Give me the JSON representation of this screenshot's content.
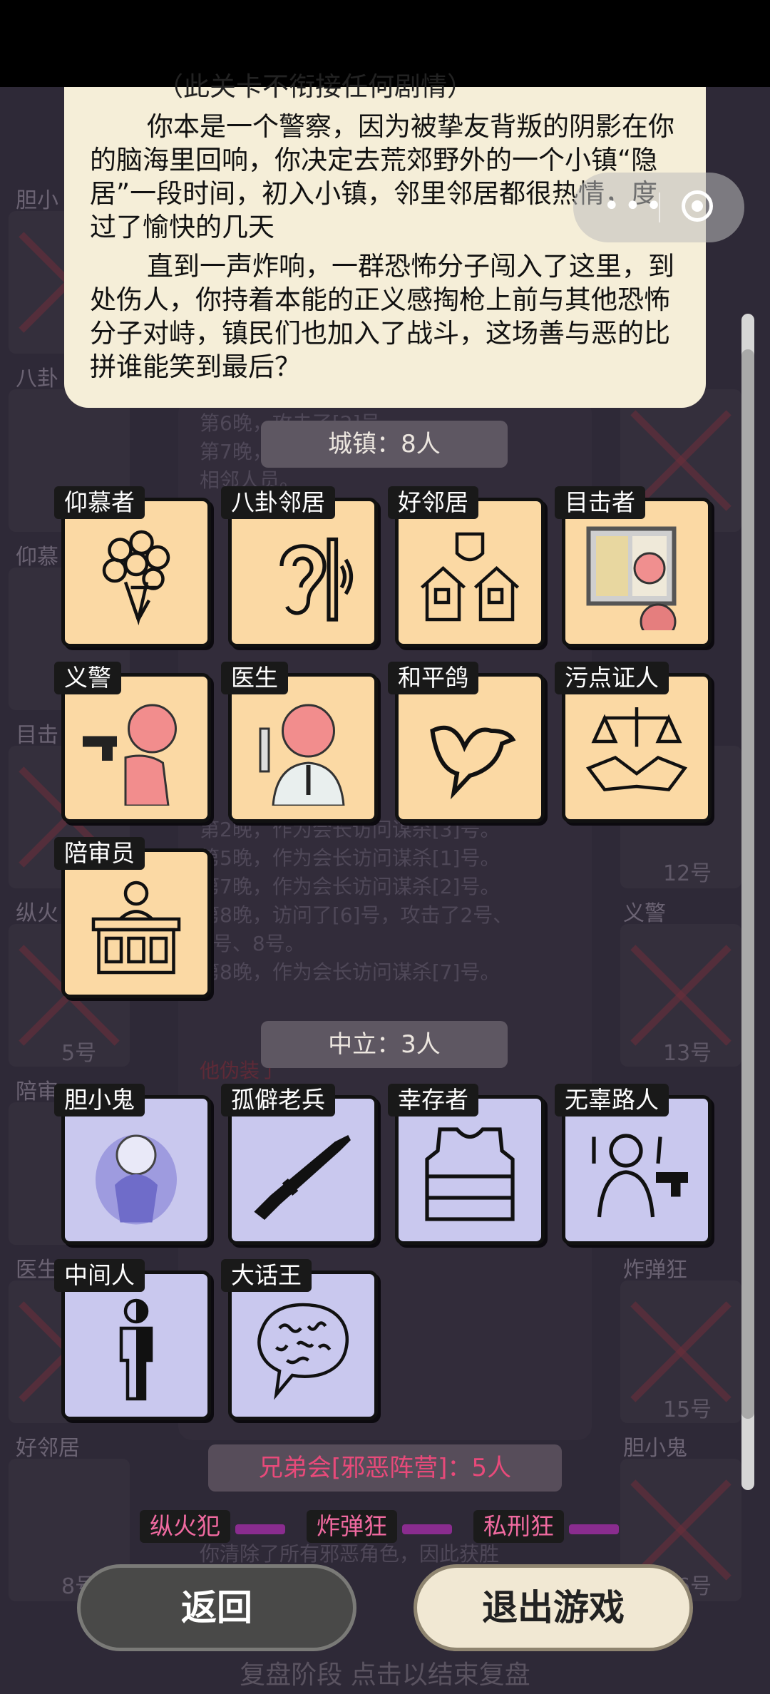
{
  "story": {
    "cut_line": "（此关卡不衔接任何剧情）",
    "paragraph1": "你本是一个警察，因为被挚友背叛的阴影在你的脑海里回响，你决定去荒郊野外的一个小镇“隐居”一段时间，初入小镇，邻里邻居都很热情，度过了愉快的几天",
    "paragraph2": "直到一声炸响，一群恐怖分子闯入了这里，到处伤人，你持着本能的正义感掏枪上前与其他恐怖分子对峙，镇民们也加入了战斗，这场善与恶的比拼谁能笑到最后？"
  },
  "mini_program": {
    "more_icon": "more-dots-icon",
    "close_icon": "target-icon"
  },
  "town": {
    "header": "城镇：8人",
    "roles": [
      {
        "name": "仰慕者",
        "icon": "bouquet-icon"
      },
      {
        "name": "八卦邻居",
        "icon": "ear-icon"
      },
      {
        "name": "好邻居",
        "icon": "houses-icon"
      },
      {
        "name": "目击者",
        "icon": "window-icon"
      },
      {
        "name": "义警",
        "icon": "gun-figure-icon"
      },
      {
        "name": "医生",
        "icon": "doctor-icon"
      },
      {
        "name": "和平鸽",
        "icon": "dove-icon"
      },
      {
        "name": "污点证人",
        "icon": "scales-icon"
      },
      {
        "name": "陪审员",
        "icon": "jury-icon"
      }
    ]
  },
  "neutral": {
    "header": "中立：3人",
    "roles": [
      {
        "name": "胆小鬼",
        "icon": "ghost-icon"
      },
      {
        "name": "孤僻老兵",
        "icon": "rifle-icon"
      },
      {
        "name": "幸存者",
        "icon": "vest-icon"
      },
      {
        "name": "无辜路人",
        "icon": "hostage-icon"
      },
      {
        "name": "中间人",
        "icon": "half-figure-icon"
      },
      {
        "name": "大话王",
        "icon": "speech-bubble-icon"
      }
    ]
  },
  "evil": {
    "header": "兄弟会[邪恶阵营]：5人",
    "roles": [
      "纵火犯",
      "炸弹狂",
      "私刑狂"
    ]
  },
  "buttons": {
    "back": "返回",
    "quit": "退出游戏"
  },
  "hint": "复盘阶段 点击以结束复盘",
  "background": {
    "left_labels": [
      "胆小",
      "八卦",
      "仰慕",
      "目击",
      "纵火",
      "陪审",
      "医生",
      "好邻居"
    ],
    "right_labels": [
      "义警",
      "炸弹狂",
      "胆小鬼"
    ],
    "numbers": [
      "5号",
      "12号",
      "13号",
      "15号",
      "8号",
      "16号"
    ],
    "log_lines": [
      "第6晚，攻击了[2]号。",
      "第7晚，攻击了[3]号，没有访问",
      "相邻人员。",
      "第2晚，作为会长访问谋杀[3]号。",
      "第5晚，作为会长访问谋杀[1]号。",
      "第7晚，作为会长访问谋杀[2]号。",
      "第8晚，访问了[6]号，攻击了2号、",
      "5号、8号。",
      "第8晚，作为会长访问谋杀[7]号。",
      "他伪装了",
      "你清除了所有邪恶角色，因此获胜"
    ]
  },
  "colors": {
    "town_card": "#fbd9a4",
    "neutral_card": "#c9c8ee",
    "evil_text": "#e84a7a",
    "story_bg": "#f5eed8"
  }
}
